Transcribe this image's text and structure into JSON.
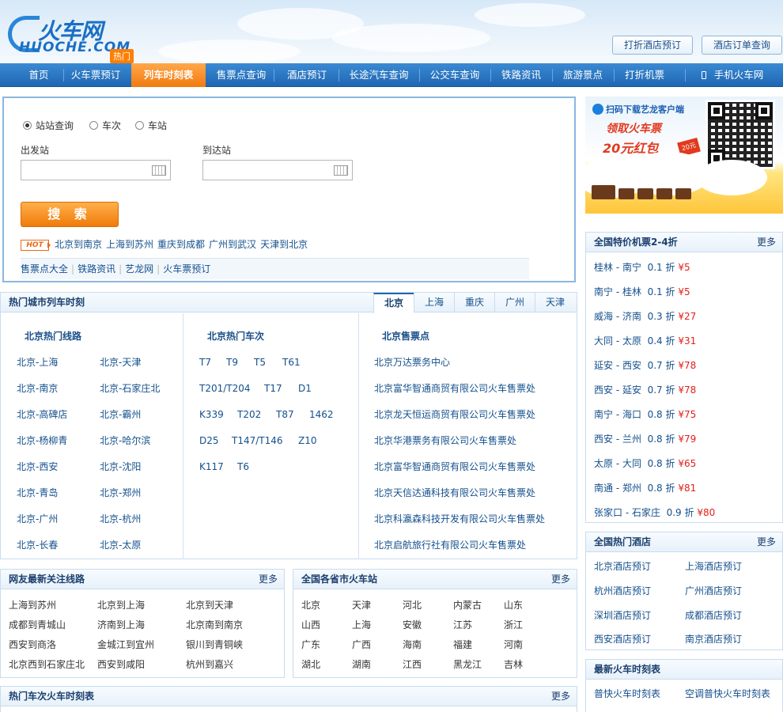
{
  "logo": {
    "main": "火车网",
    "sub": "HUOCHE.COM"
  },
  "hot_tag": "热门",
  "top_buttons": [
    "打折酒店预订",
    "酒店订单查询"
  ],
  "nav": [
    "首页",
    "火车票预订",
    "列车时刻表",
    "售票点查询",
    "酒店预订",
    "长途汽车查询",
    "公交车查询",
    "铁路资讯",
    "旅游景点",
    "打折机票",
    "手机火车网"
  ],
  "search": {
    "modes": [
      "站站查询",
      "车次",
      "车站"
    ],
    "from_label": "出发站",
    "to_label": "到达站",
    "button": "搜 索",
    "hot_badge": "HOT",
    "hot_routes": [
      "北京到南京",
      "上海到苏州",
      "重庆到成都",
      "广州到武汉",
      "天津到北京"
    ],
    "quick_links": [
      "售票点大全",
      "铁路资讯",
      "艺龙网",
      "火车票预订"
    ]
  },
  "ad": {
    "top": "扫码下载艺龙客户端",
    "line1": "领取火车票",
    "line2": "20元红包",
    "tag": "20元"
  },
  "hot_cities": {
    "title": "热门城市列车时刻",
    "tabs": [
      "北京",
      "上海",
      "重庆",
      "广州",
      "天津"
    ],
    "routes_title": "北京热门线路",
    "routes": [
      "北京-上海",
      "北京-天津",
      "北京-南京",
      "北京-石家庄北",
      "北京-高碑店",
      "北京-霸州",
      "北京-杨柳青",
      "北京-哈尔滨",
      "北京-西安",
      "北京-沈阳",
      "北京-青岛",
      "北京-郑州",
      "北京-广州",
      "北京-杭州",
      "北京-长春",
      "北京-太原"
    ],
    "trains_title": "北京热门车次",
    "trains": [
      [
        "T7",
        "T9",
        "T5",
        "T61"
      ],
      [
        "T201/T204",
        "T17",
        "D1"
      ],
      [
        "K339",
        "T202",
        "T87",
        "1462"
      ],
      [
        "D25",
        "T147/T146",
        "Z10"
      ],
      [
        "K117",
        "T6"
      ]
    ],
    "outlets_title": "北京售票点",
    "outlets": [
      "北京万达票务中心",
      "北京富华智通商贸有限公司火车售票处",
      "北京龙天恒运商贸有限公司火车售票处",
      "北京华港票务有限公司火车售票处",
      "北京富华智通商贸有限公司火车售票处",
      "北京天信达通科技有限公司火车售票处",
      "北京科瀛森科技开发有限公司火车售票处",
      "北京启航旅行社有限公司火车售票处"
    ]
  },
  "deals": {
    "title": "全国特价机票2-4折",
    "more": "更多",
    "items": [
      {
        "route": "桂林 - 南宁",
        "disc": "0.1 折",
        "price": "¥5"
      },
      {
        "route": "南宁 - 桂林",
        "disc": "0.1 折",
        "price": "¥5"
      },
      {
        "route": "威海 - 济南",
        "disc": "0.3 折",
        "price": "¥27"
      },
      {
        "route": "大同 - 太原",
        "disc": "0.4 折",
        "price": "¥31"
      },
      {
        "route": "延安 - 西安",
        "disc": "0.7 折",
        "price": "¥78"
      },
      {
        "route": "西安 - 延安",
        "disc": "0.7 折",
        "price": "¥78"
      },
      {
        "route": "南宁 - 海口",
        "disc": "0.8 折",
        "price": "¥75"
      },
      {
        "route": "西安 - 兰州",
        "disc": "0.8 折",
        "price": "¥79"
      },
      {
        "route": "太原 - 大同",
        "disc": "0.8 折",
        "price": "¥65"
      },
      {
        "route": "南通 - 郑州",
        "disc": "0.8 折",
        "price": "¥81"
      },
      {
        "route": "张家口 - 石家庄",
        "disc": "0.9 折",
        "price": "¥80"
      }
    ]
  },
  "hotels": {
    "title": "全国热门酒店",
    "more": "更多",
    "items": [
      "北京酒店预订",
      "上海酒店预订",
      "杭州酒店预订",
      "广州酒店预订",
      "深圳酒店预订",
      "成都酒店预订",
      "西安酒店预订",
      "南京酒店预订"
    ]
  },
  "latest": {
    "title": "最新火车时刻表",
    "items": [
      "普快火车时刻表",
      "空调普快火车时刻表"
    ]
  },
  "user_routes": {
    "title": "网友最新关注线路",
    "more": "更多",
    "items": [
      "上海到苏州",
      "北京到上海",
      "北京到天津",
      "成都到青城山",
      "济南到上海",
      "北京南到南京",
      "西安到商洛",
      "金城江到宜州",
      "银川到青铜峡",
      "北京西到石家庄北",
      "西安到咸阳",
      "杭州到嘉兴"
    ]
  },
  "stations": {
    "title": "全国各省市火车站",
    "more": "更多",
    "items": [
      "北京",
      "天津",
      "河北",
      "内蒙古",
      "山东",
      "山西",
      "上海",
      "安徽",
      "江苏",
      "浙江",
      "广东",
      "广西",
      "海南",
      "福建",
      "河南",
      "湖北",
      "湖南",
      "江西",
      "黑龙江",
      "吉林"
    ]
  },
  "hot_trains": {
    "title": "热门车次火车时刻表",
    "more": "更多"
  }
}
